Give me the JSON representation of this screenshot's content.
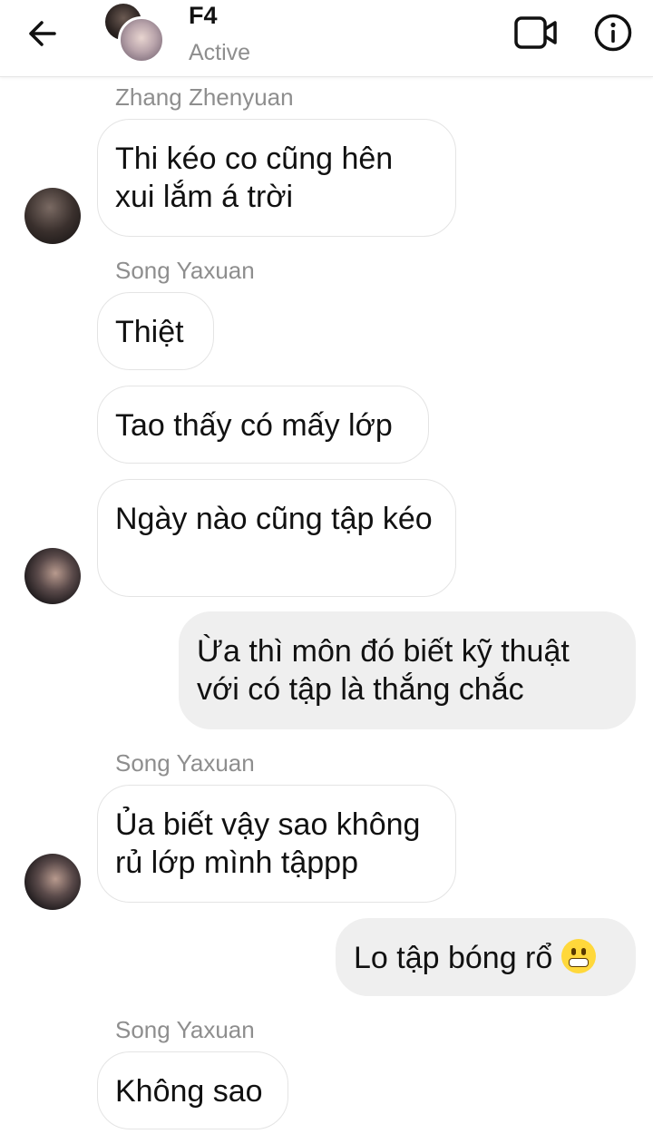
{
  "header": {
    "title": "F4",
    "status": "Active",
    "icons": {
      "back": "back-arrow-icon",
      "video": "video-call-icon",
      "info": "info-icon"
    }
  },
  "messages": [
    {
      "sender": "Zhang Zhenyuan",
      "text": "Thi kéo co cũng hên xui lắm á trời",
      "from_me": false
    },
    {
      "sender": "Song Yaxuan",
      "text": "Thiệt",
      "from_me": false
    },
    {
      "text": "Tao thấy có mấy lớp",
      "from_me": false
    },
    {
      "text": "Ngày nào cũng tập kéo",
      "from_me": false
    },
    {
      "text": "Ừa thì môn đó biết kỹ thuật với có tập là thắng chắc",
      "from_me": true
    },
    {
      "sender": "Song Yaxuan",
      "text": "Ủa biết vậy sao không rủ lớp mình tậppp",
      "from_me": false
    },
    {
      "text": "Lo tập bóng rổ",
      "emoji": "grimacing-face",
      "from_me": true
    },
    {
      "sender": "Song Yaxuan",
      "text": "Không sao",
      "from_me": false
    }
  ]
}
